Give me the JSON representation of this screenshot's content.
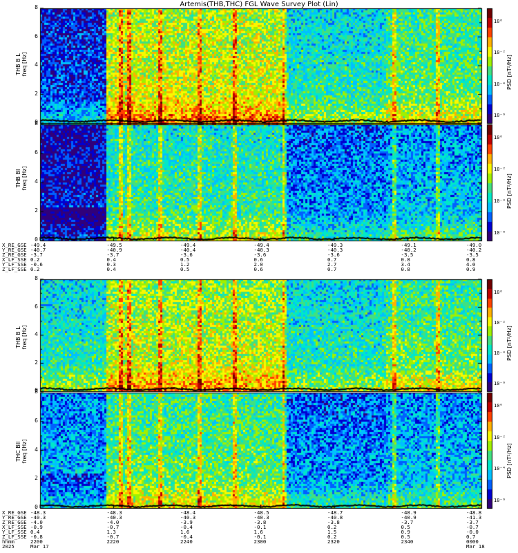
{
  "title": "Artemis(THB,THC) FGL Wave Survey Plot (Lin)",
  "colors": {
    "colormap": [
      "#30007a",
      "#0000d0",
      "#0060ff",
      "#00c0ff",
      "#00e8c8",
      "#40e080",
      "#a0f000",
      "#f8f800",
      "#ffb000",
      "#ff4000",
      "#c00000",
      "#700000"
    ],
    "trace": "#000000"
  },
  "chart_data": [
    {
      "type": "heatmap",
      "panel": "top-1",
      "ylabel_line1": "THB B L",
      "ylabel_line2": "freq [Hz]",
      "ylim": [
        0,
        8
      ],
      "yticks": [
        "0",
        "2",
        "4",
        "6",
        "8"
      ],
      "colorbar_label": "PSD [nT²/Hz]",
      "colorbar_ticks": [
        "10⁰",
        "10⁻²",
        "10⁻⁴",
        "10⁻⁶"
      ],
      "colorbar_scale": "log",
      "intensity_profile": "left quarter low (dark blue), bright yellow/green between ~2205-2300, moderate cyan-green elsewhere; strongest power near 0-2 Hz"
    },
    {
      "type": "heatmap",
      "panel": "top-2",
      "ylabel_line1": "THB BI",
      "ylabel_line2": "freq [Hz]",
      "ylim": [
        0,
        8
      ],
      "yticks": [
        "0",
        "2",
        "4",
        "6",
        "8"
      ],
      "colorbar_label": "PSD [nT²/Hz]",
      "colorbar_ticks": [
        "10⁰",
        "10⁻²",
        "10⁻⁴",
        "10⁻⁶"
      ],
      "colorbar_scale": "log"
    },
    {
      "type": "heatmap",
      "panel": "bottom-1",
      "ylabel_line1": "THB B L",
      "ylabel_line2": "freq [Hz]",
      "ylim": [
        0,
        8
      ],
      "yticks": [
        "0",
        "2",
        "4",
        "6",
        "8"
      ],
      "colorbar_label": "PSD [nT²/Hz]",
      "colorbar_ticks": [
        "10⁰",
        "10⁻²",
        "10⁻⁴",
        "10⁻⁶"
      ],
      "colorbar_scale": "log"
    },
    {
      "type": "heatmap",
      "panel": "bottom-2",
      "ylabel_line1": "THC BII",
      "ylabel_line2": "freq [Hz]",
      "ylim": [
        0,
        8
      ],
      "yticks": [
        "0",
        "2",
        "4",
        "6",
        "8"
      ],
      "colorbar_label": "PSD [nT²/Hz]",
      "colorbar_ticks": [
        "10⁰",
        "10⁻²",
        "10⁻⁴",
        "10⁻⁶"
      ],
      "colorbar_scale": "log"
    }
  ],
  "ephemeris_top": {
    "labels": [
      "X_RE_GSE",
      "Y_RE_GSE",
      "Z_RE_GSE",
      "X_LF_SSE",
      "Y_LF_SSE",
      "Z_LF_SSE"
    ],
    "columns": [
      [
        "-49.4",
        "-40.7",
        "-3.7",
        "0.2",
        "-0.6",
        "0.2"
      ],
      [
        "-49.5",
        "-40.9",
        "-3.7",
        "0.4",
        "0.3",
        "0.4"
      ],
      [
        "-49.4",
        "-40.4",
        "-3.6",
        "0.5",
        "1.2",
        "0.5"
      ],
      [
        "-49.4",
        "-40.3",
        "-3.6",
        "0.6",
        "2.0",
        "0.6"
      ],
      [
        "-49.3",
        "-40.3",
        "-3.6",
        "0.7",
        "2.7",
        "0.7"
      ],
      [
        "-49.1",
        "-40.2",
        "-3.5",
        "0.8",
        "3.4",
        "0.8"
      ],
      [
        "-49.0",
        "-40.2",
        "-3.5",
        "0.8",
        "4.0",
        "0.9"
      ]
    ]
  },
  "ephemeris_bottom": {
    "labels": [
      "X_RE_GSE",
      "Y_RE_GSE",
      "Z_RE_GSE",
      "X_LF_SSE",
      "Y_LF_SSE",
      "Z_LF_SSE",
      "hhmm",
      "2025"
    ],
    "columns": [
      [
        "-48.3",
        "-40.3",
        "-4.0",
        "-0.9",
        "0.4",
        "-0.8",
        "2200",
        "Mar 17"
      ],
      [
        "-48.3",
        "-40.3",
        "-4.0",
        "-0.7",
        "1.3",
        "-0.7",
        "2220",
        ""
      ],
      [
        "-48.4",
        "-40.3",
        "-3.9",
        "-0.4",
        "1.6",
        "-0.4",
        "2240",
        ""
      ],
      [
        "-48.5",
        "-40.3",
        "-3.8",
        "-0.1",
        "1.6",
        "-0.1",
        "2300",
        ""
      ],
      [
        "-48.7",
        "-40.8",
        "-3.8",
        "0.2",
        "1.5",
        "0.2",
        "2320",
        ""
      ],
      [
        "-48.9",
        "-40.9",
        "-3.7",
        "0.5",
        "0.9",
        "0.5",
        "2340",
        ""
      ],
      [
        "-48.8",
        "-41.3",
        "-3.7",
        "-0.7",
        "-0.0",
        "0.7",
        "0000",
        "Mar 18"
      ]
    ]
  }
}
